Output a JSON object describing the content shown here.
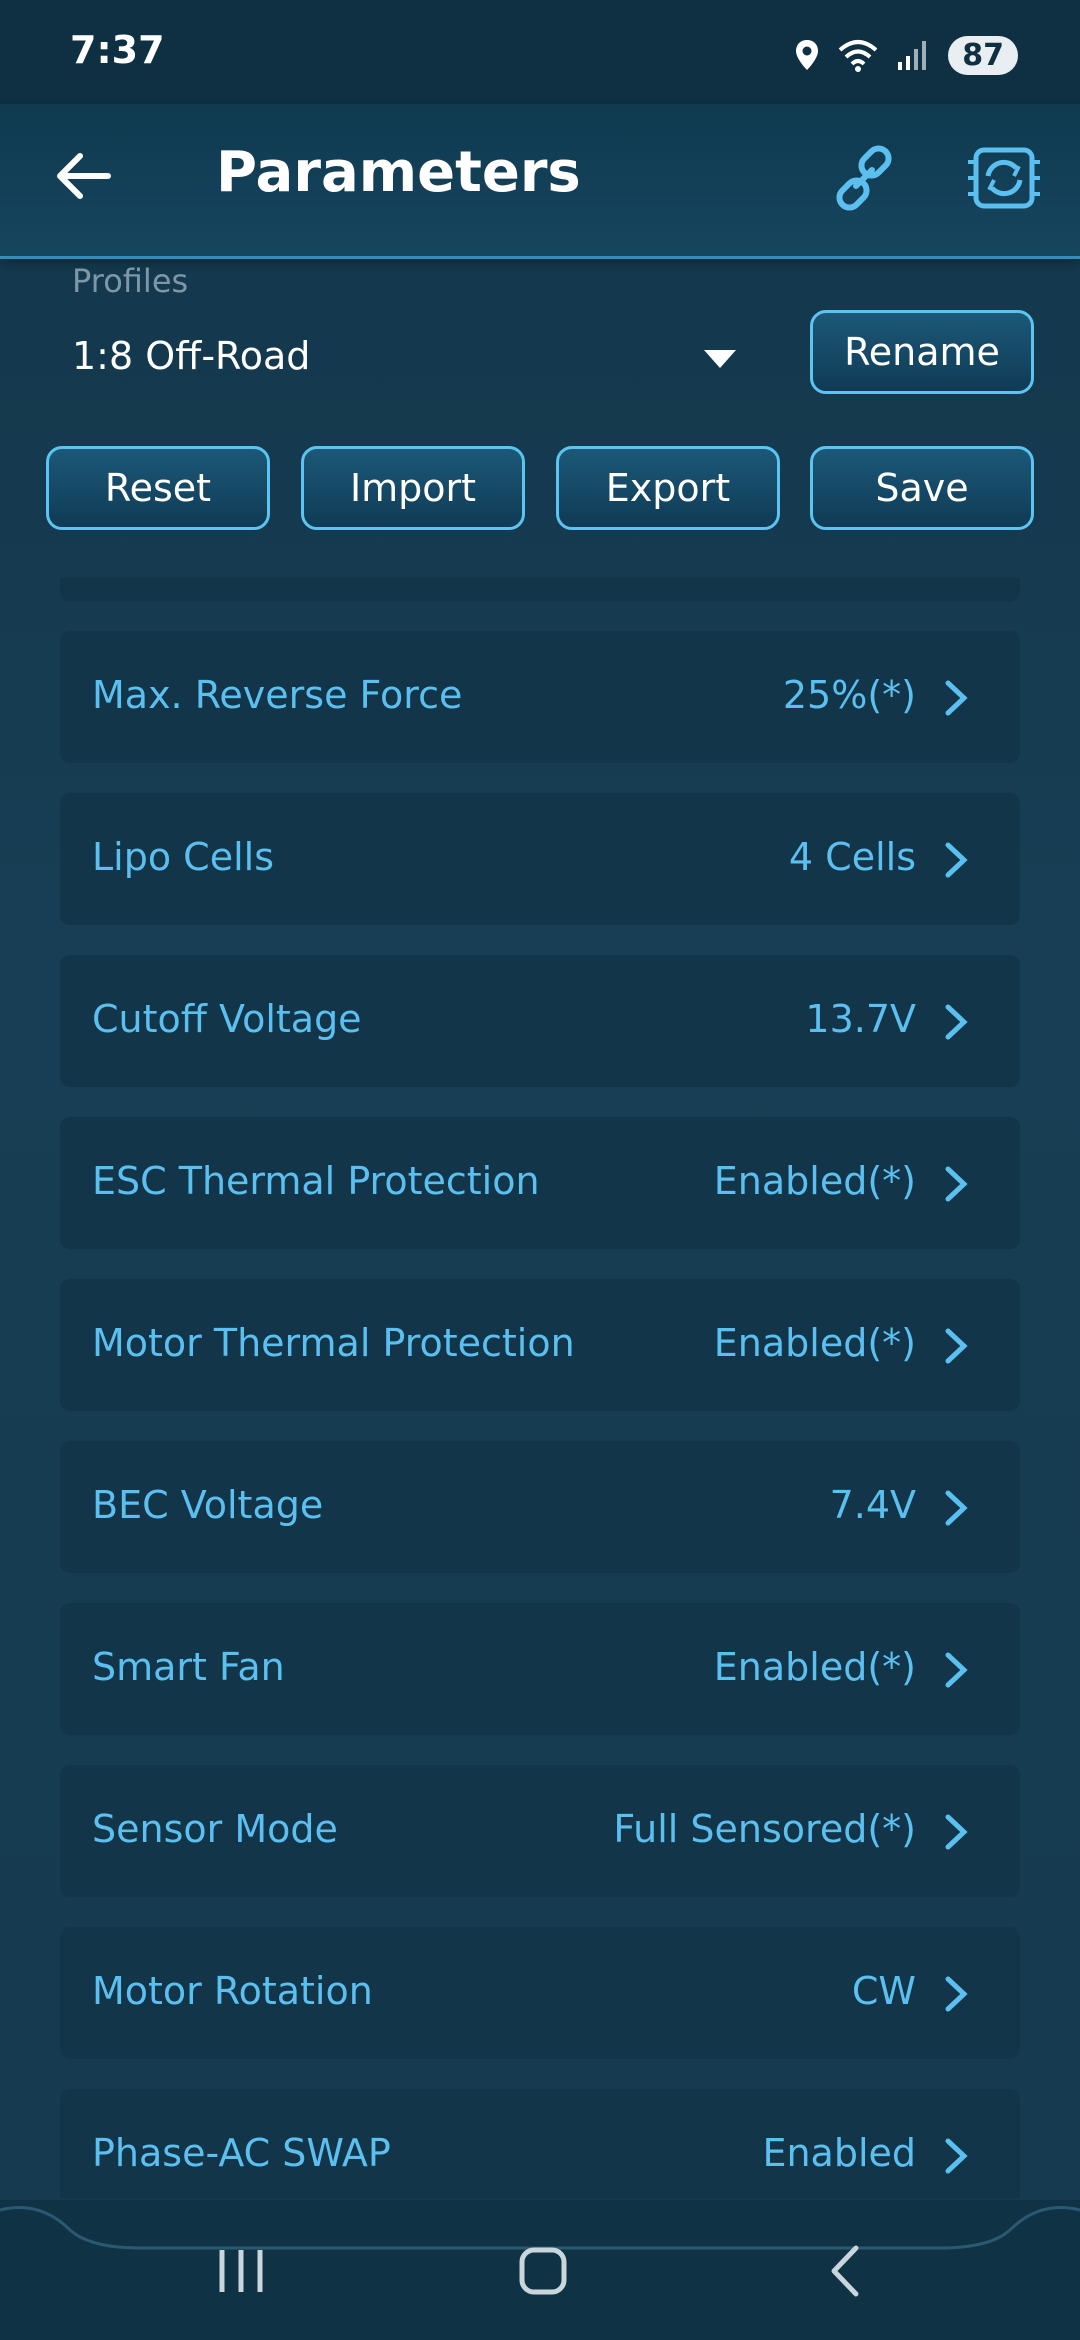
{
  "status_bar": {
    "time": "7:37",
    "battery": "87",
    "icons": [
      "location-icon",
      "wifi-icon",
      "signal-icon",
      "battery-icon"
    ]
  },
  "app_bar": {
    "title": "Parameters",
    "back_icon": "arrow-left-icon",
    "link_icon": "link-icon",
    "sync_icon": "chip-sync-icon"
  },
  "profiles": {
    "label": "Profiles",
    "selected": "1:8 Off-Road",
    "rename_label": "Rename"
  },
  "actions": {
    "reset_label": "Reset",
    "import_label": "Import",
    "export_label": "Export",
    "save_label": "Save"
  },
  "parameters": [
    {
      "label": "Max. Reverse Force",
      "value": "25%(*)"
    },
    {
      "label": "Lipo Cells",
      "value": "4 Cells"
    },
    {
      "label": "Cutoff Voltage",
      "value": "13.7V"
    },
    {
      "label": "ESC Thermal Protection",
      "value": "Enabled(*)"
    },
    {
      "label": "Motor Thermal Protection",
      "value": "Enabled(*)"
    },
    {
      "label": "BEC Voltage",
      "value": "7.4V"
    },
    {
      "label": "Smart Fan",
      "value": "Enabled(*)"
    },
    {
      "label": "Sensor Mode",
      "value": "Full Sensored(*)"
    },
    {
      "label": "Motor Rotation",
      "value": "CW"
    },
    {
      "label": "Phase-AC SWAP",
      "value": "Enabled"
    }
  ],
  "colors": {
    "accent": "#5bbfef",
    "background": "#163a4f",
    "row": "#123549",
    "button_border": "#5cc4f0"
  },
  "nav_bar": {
    "icons": [
      "recents-icon",
      "home-icon",
      "back-icon"
    ]
  }
}
